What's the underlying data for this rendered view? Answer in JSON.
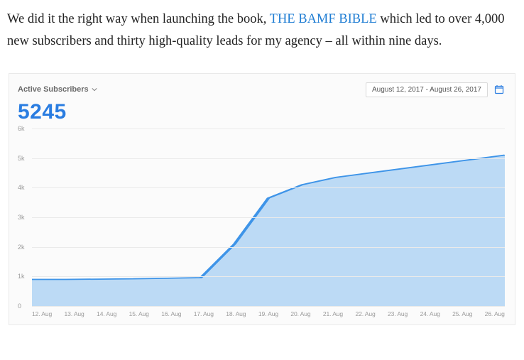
{
  "article": {
    "text_before": "We did it the right way when launching the book, ",
    "link_text": "THE BAMF BIBLE",
    "text_after": " which led to over 4,000 new subscribers and thirty high-quality leads for my agency – all within nine days."
  },
  "screenshot": {
    "metric_label": "Active Subscribers",
    "date_range": "August 12, 2017 - August 26, 2017",
    "big_number": "5245"
  },
  "chart_data": {
    "type": "area",
    "title": "Active Subscribers",
    "xlabel": "",
    "ylabel": "",
    "ylim": [
      0,
      6000
    ],
    "y_ticks": [
      "6k",
      "5k",
      "4k",
      "3k",
      "2k",
      "1k",
      "0"
    ],
    "categories": [
      "12. Aug",
      "13. Aug",
      "14. Aug",
      "15. Aug",
      "16. Aug",
      "17. Aug",
      "18. Aug",
      "19. Aug",
      "20. Aug",
      "21. Aug",
      "22. Aug",
      "23. Aug",
      "24. Aug",
      "25. Aug",
      "26. Aug"
    ],
    "values": [
      900,
      900,
      910,
      920,
      940,
      960,
      2100,
      3650,
      4100,
      4350,
      4500,
      4650,
      4800,
      4950,
      5100
    ],
    "line_color": "#3e94e8",
    "fill_color": "#bcdaf5"
  }
}
